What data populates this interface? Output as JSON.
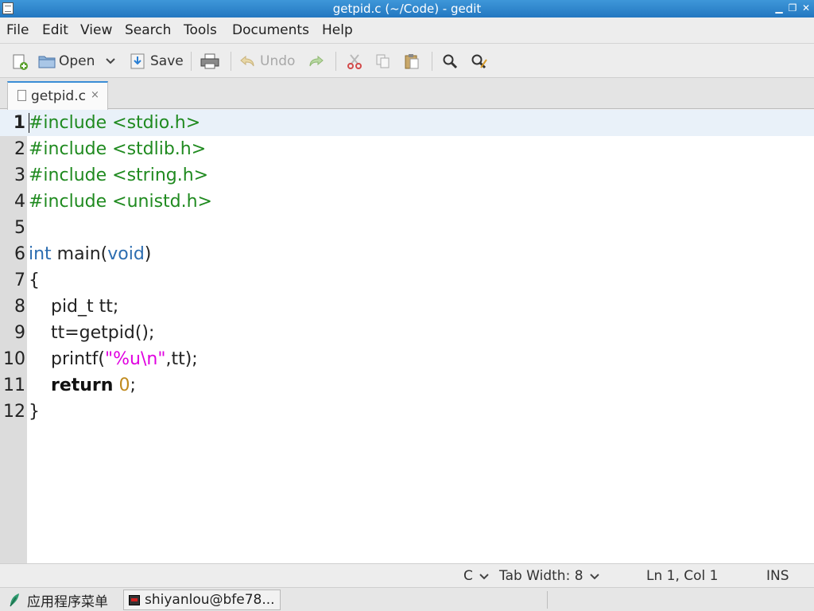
{
  "window": {
    "title": "getpid.c (~/Code) - gedit"
  },
  "menu": [
    "File",
    "Edit",
    "View",
    "Search",
    "Tools",
    "Documents",
    "Help"
  ],
  "toolbar": {
    "open_label": "Open",
    "save_label": "Save",
    "undo_label": "Undo"
  },
  "tab": {
    "label": "getpid.c",
    "close": "×"
  },
  "editor": {
    "lines": [
      {
        "num": "1",
        "text": "#include <stdio.h>"
      },
      {
        "num": "2",
        "text": "#include <stdlib.h>"
      },
      {
        "num": "3",
        "text": "#include <string.h>"
      },
      {
        "num": "4",
        "text": "#include <unistd.h>"
      },
      {
        "num": "5",
        "text": ""
      },
      {
        "num": "6",
        "text": "int main(void)"
      },
      {
        "num": "7",
        "text": "{"
      },
      {
        "num": "8",
        "text": "    pid_t tt;"
      },
      {
        "num": "9",
        "text": "    tt=getpid();"
      },
      {
        "num": "10",
        "text": "    printf(\"%u\\n\",tt);"
      },
      {
        "num": "11",
        "text": "    return 0;"
      },
      {
        "num": "12",
        "text": "}"
      }
    ]
  },
  "status": {
    "language": "C",
    "tab_width": "Tab Width: 8",
    "position": "Ln 1, Col 1",
    "mode": "INS"
  },
  "taskbar": {
    "start_label": "应用程序菜单",
    "window_label": "shiyanlou@bfe78..."
  }
}
